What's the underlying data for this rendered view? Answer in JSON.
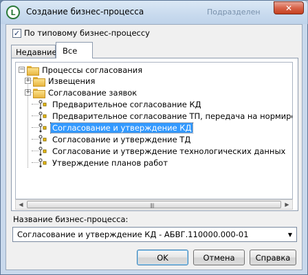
{
  "window": {
    "title": "Создание бизнес-процесса",
    "background_ghost_text": "Подразделен",
    "close_glyph": "✕"
  },
  "checkbox": {
    "label": "По типовому бизнес-процессу",
    "checked": true
  },
  "tabs": [
    {
      "label": "Недавние",
      "active": false
    },
    {
      "label": "Все",
      "active": true
    }
  ],
  "tree": {
    "root": {
      "label": "Процессы согласования",
      "expanded": true
    },
    "items": [
      {
        "label": "Извещения",
        "type": "folder",
        "expandable": true
      },
      {
        "label": "Согласование заявок",
        "type": "folder",
        "expandable": true
      },
      {
        "label": "Предварительное согласование КД",
        "type": "process"
      },
      {
        "label": "Предварительное согласование ТП, передача на нормирован",
        "type": "process"
      },
      {
        "label": "Согласование и утверждение КД",
        "type": "process",
        "selected": true
      },
      {
        "label": "Согласование и утверждение ТД",
        "type": "process"
      },
      {
        "label": "Согласование и утверждение технологических данных",
        "type": "process"
      },
      {
        "label": "Утверждение планов работ",
        "type": "process"
      }
    ]
  },
  "name_field": {
    "label": "Название бизнес-процесса:",
    "value": "Согласование и утверждение КД - АБВГ.110000.000-01"
  },
  "buttons": {
    "ok": "OK",
    "cancel": "Отмена",
    "help": "Справка"
  },
  "colors": {
    "selection": "#3399ff",
    "titlebar": "#c8daee",
    "close": "#c4401f"
  }
}
